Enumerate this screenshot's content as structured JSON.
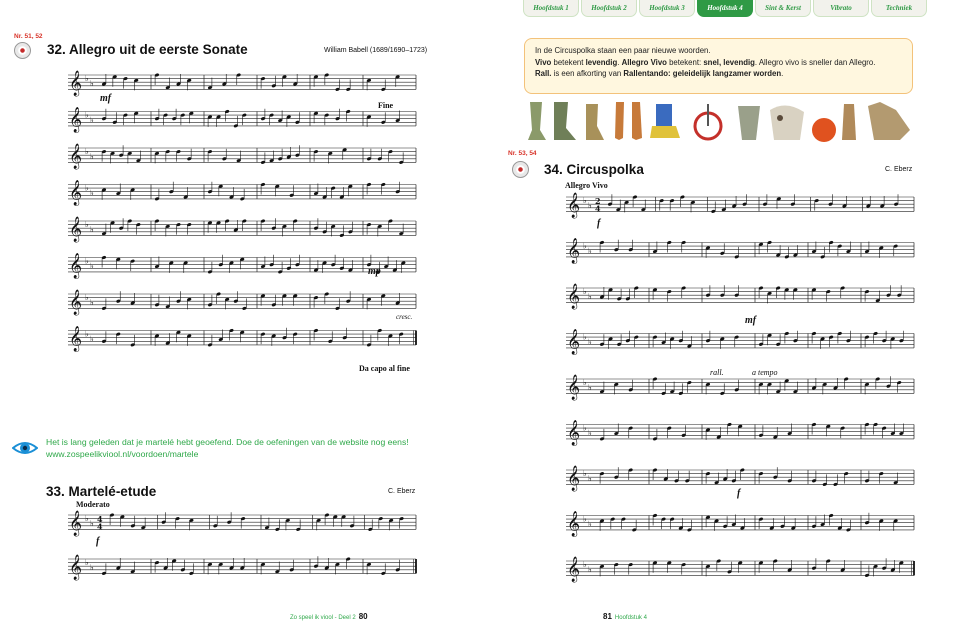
{
  "left_page": {
    "piece32": {
      "track": "Nr. 51, 52",
      "number": "32.",
      "title": "Allegro uit de eerste Sonate",
      "composer": "William Babell (1689/1690–1723)",
      "marks": {
        "dynamic1": "mf",
        "fine": "Fine",
        "dynamic2": "mp",
        "cresc": "cresc.",
        "da_capo": "Da capo al fine"
      }
    },
    "tip": {
      "line1": "Het is lang geleden dat je martelé hebt geoefend. Doe de oefeningen van de website nog eens!",
      "line2": "www.zospeelikviool.nl/voordoen/martele"
    },
    "piece33": {
      "number": "33.",
      "title": "Martelé-etude",
      "composer": "C. Eberz",
      "tempo": "Moderato",
      "dynamic": "f"
    },
    "footer": {
      "book": "Zo speel ik viool - Deel 2",
      "page": "80"
    }
  },
  "right_page": {
    "tabs": [
      "Hoofdstuk 1",
      "Hoofdstuk 2",
      "Hoofdstuk 3",
      "Hoofdstuk 4",
      "Sint & Kerst",
      "Vibrato",
      "Techniek"
    ],
    "active_tab": 3,
    "info": {
      "line1": "In de Circuspolka staan een paar nieuwe woorden.",
      "line2_a": "Vivo",
      "line2_b": " betekent ",
      "line2_c": "levendig",
      "line2_d": ". ",
      "line2_e": "Allegro Vivo",
      "line2_f": " betekent: ",
      "line2_g": "snel, levendig",
      "line2_h": ". Allegro vivo is sneller dan Allegro.",
      "line3_a": "Rall.",
      "line3_b": " is een afkorting van ",
      "line3_c": "Rallentando: geleidelijk langzamer worden",
      "line3_d": "."
    },
    "piece34": {
      "track": "Nr. 53, 54",
      "number": "34.",
      "title": "Circuspolka",
      "composer": "C. Eberz",
      "tempo": "Allegro Vivo",
      "marks": {
        "dyn1": "f",
        "dyn2": "mf",
        "rall": "rall.",
        "a_tempo": "a tempo",
        "dyn3": "f"
      }
    },
    "footer": {
      "page": "81",
      "chapter": "Hoofdstuk 4"
    }
  },
  "colors": {
    "accent_green": "#2fa84a",
    "track_red": "#d8342a",
    "info_bg": "#fff7df",
    "info_border": "#f3c27a"
  }
}
